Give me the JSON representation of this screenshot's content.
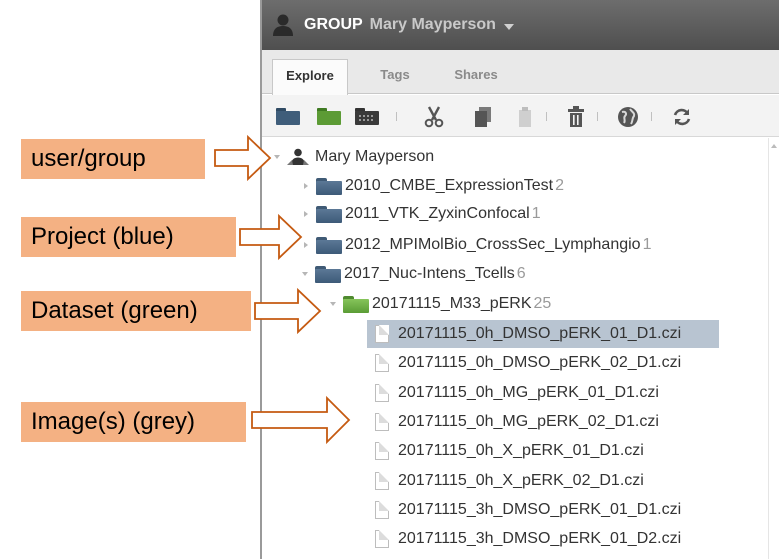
{
  "header": {
    "group_label": "GROUP",
    "owner_name": "Mary Mayperson",
    "user_icon": "user-silhouette-icon",
    "dropdown_icon": "caret-down-icon",
    "background": "#5c5c5c"
  },
  "tabs": [
    {
      "label": "Explore",
      "active": true
    },
    {
      "label": "Tags",
      "active": false
    },
    {
      "label": "Shares",
      "active": false
    }
  ],
  "toolbar": [
    {
      "icon": "new-project-folder-icon"
    },
    {
      "icon": "new-dataset-folder-icon"
    },
    {
      "icon": "screen-plate-icon"
    },
    {
      "icon": "cut-icon"
    },
    {
      "icon": "copy-icon"
    },
    {
      "icon": "paste-icon"
    },
    {
      "icon": "delete-icon"
    },
    {
      "icon": "share-globe-icon"
    },
    {
      "icon": "refresh-icon"
    }
  ],
  "tree": {
    "root": {
      "label": "Mary Mayperson",
      "icon": "user-icon",
      "expanded": true
    },
    "projects": [
      {
        "name": "2010_CMBE_ExpressionTest",
        "count": "2"
      },
      {
        "name": "2011_VTK_ZyxinConfocal",
        "count": "1"
      },
      {
        "name": "2012_MPIMolBio_CrossSec_Lymphangio",
        "count": "1"
      },
      {
        "name": "2017_Nuc-Intens_Tcells",
        "count": "6"
      }
    ],
    "dataset": {
      "name": "20171115_M33_pERK",
      "count": "25"
    },
    "images": [
      {
        "name": "20171115_0h_DMSO_pERK_01_D1.czi",
        "selected": true
      },
      {
        "name": "20171115_0h_DMSO_pERK_02_D1.czi",
        "selected": false
      },
      {
        "name": "20171115_0h_MG_pERK_01_D1.czi",
        "selected": false
      },
      {
        "name": "20171115_0h_MG_pERK_02_D1.czi",
        "selected": false
      },
      {
        "name": "20171115_0h_X_pERK_01_D1.czi",
        "selected": false
      },
      {
        "name": "20171115_0h_X_pERK_02_D1.czi",
        "selected": false
      },
      {
        "name": "20171115_3h_DMSO_pERK_01_D1.czi",
        "selected": false
      },
      {
        "name": "20171115_3h_DMSO_pERK_01_D2.czi",
        "selected": false
      }
    ],
    "colors": {
      "project": "#4a6785",
      "dataset": "#6fb245",
      "selected_row": "#b8c4d1"
    }
  },
  "annotations": [
    {
      "label": "user/group"
    },
    {
      "label": "Project (blue)"
    },
    {
      "label": "Dataset (green)"
    },
    {
      "label": "Image(s) (grey)"
    }
  ],
  "annotation_color": "#f4b183"
}
